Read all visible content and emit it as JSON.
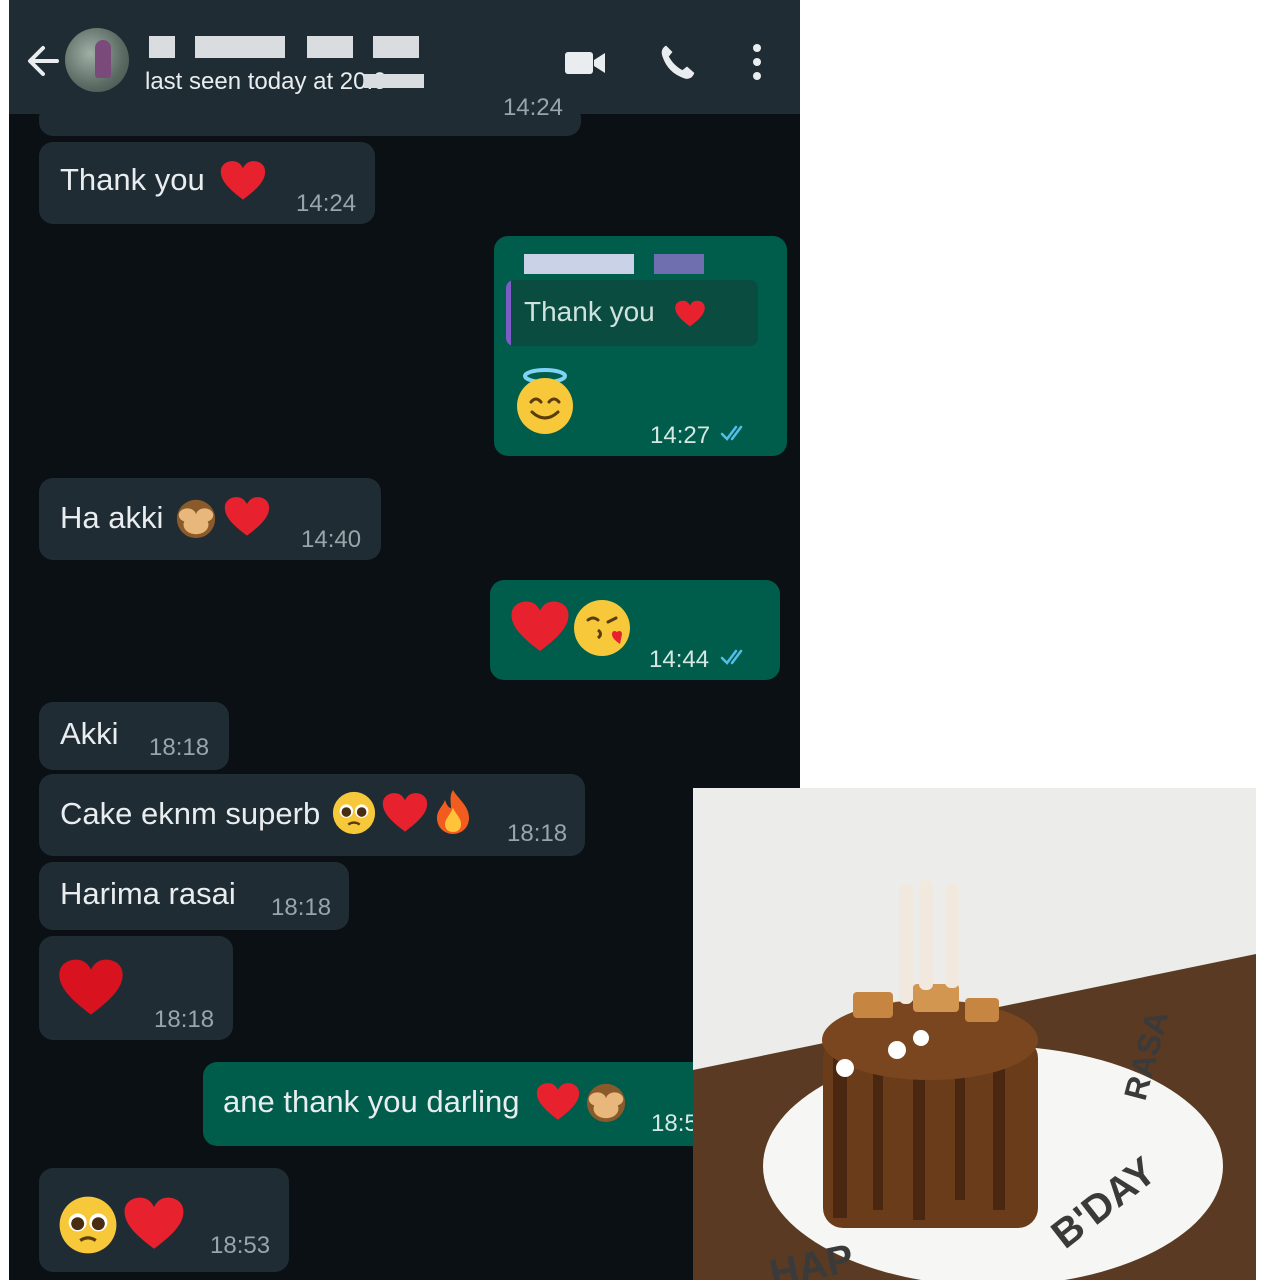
{
  "header": {
    "contact_name": "",
    "status": "last seen today at 20:0",
    "back_icon": "arrow-left-icon",
    "video_icon": "video-call-icon",
    "call_icon": "phone-icon",
    "menu_icon": "more-vert-icon"
  },
  "messages": [
    {
      "direction": "in",
      "text": "",
      "time": "14:24"
    },
    {
      "direction": "in",
      "text": "Thank you",
      "emoji": "red-heart",
      "time": "14:24"
    },
    {
      "direction": "out",
      "reply_to": "Thank you",
      "emoji": "smiling-face-with-halo",
      "time": "14:27",
      "read": true
    },
    {
      "direction": "in",
      "text": "Ha akki",
      "emoji": "see-no-evil-monkey, red-heart",
      "time": "14:40"
    },
    {
      "direction": "out",
      "emoji": "red-heart, face-blowing-kiss",
      "time": "14:44",
      "read": true
    },
    {
      "direction": "in",
      "text": "Akki",
      "time": "18:18"
    },
    {
      "direction": "in",
      "text": "Cake eknm superb",
      "emoji": "pleading-face, red-heart, fire",
      "time": "18:18"
    },
    {
      "direction": "in",
      "text": "Harima rasai",
      "time": "18:18"
    },
    {
      "direction": "in",
      "emoji": "red-heart",
      "time": "18:18"
    },
    {
      "direction": "out",
      "text": "ane thank you darling",
      "emoji": "red-heart, see-no-evil-monkey",
      "time": "18:5"
    },
    {
      "direction": "in",
      "emoji": "pleading-face, red-heart",
      "time": "18:53"
    }
  ],
  "photo": {
    "subject": "chocolate drip birthday cake",
    "board_text_1": "RASA",
    "board_text_2": "B'DAY",
    "board_text_3": "HAP"
  },
  "colors": {
    "header_bg": "#1f2c33",
    "chat_bg": "#0b1014",
    "incoming_bubble": "#1f2c33",
    "outgoing_bubble": "#005c4b",
    "read_tick": "#53bdeb"
  }
}
